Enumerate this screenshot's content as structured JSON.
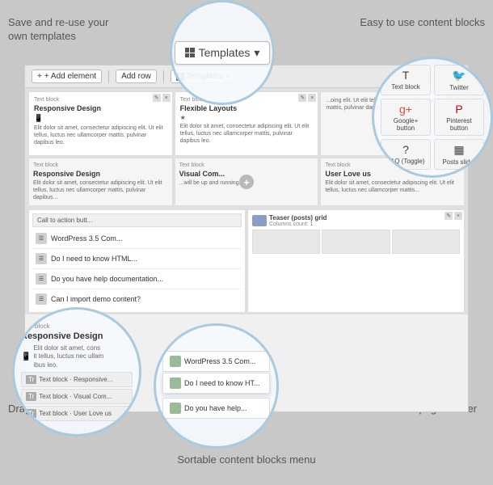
{
  "annotations": {
    "top_left": "Save and re-use your\nown templates",
    "top_right": "Easy to use content blocks",
    "bottom_left": "Drag and Drop interface",
    "bottom_right": "Powerful page builder",
    "bottom_center": "Sortable content blocks menu"
  },
  "toolbar": {
    "add_element": "+ Add element",
    "add_row": "Add row",
    "templates": "Templates"
  },
  "templates_button": {
    "label": "Templates",
    "arrow": "▾"
  },
  "content_blocks": {
    "items": [
      {
        "icon": "T",
        "label": "Text block"
      },
      {
        "icon": "🐦",
        "label": "Twitter"
      },
      {
        "icon": "g+",
        "label": "Google+ button"
      },
      {
        "icon": "P",
        "label": "Pinterest button"
      },
      {
        "icon": "?",
        "label": "FAQ (Toggle)"
      },
      {
        "icon": "▦",
        "label": "Posts slider"
      }
    ]
  },
  "drag_panel": {
    "header": "Text block",
    "title": "Responsive Design",
    "icon": "📱",
    "text": "Elit dolor sit amet, cons\nit tellus, luctus nec ullam\nibus leo.",
    "small_rows": [
      {
        "icon": "Tr",
        "label": "Text block\nResponsive Design"
      },
      {
        "icon": "Tr",
        "label": "Text block\nVisual Com..."
      },
      {
        "icon": "Tr",
        "label": "Text block\nUser Love us"
      }
    ]
  },
  "sortable_items": [
    {
      "label": "WordPress 3.5 Com..."
    },
    {
      "label": "Do I need to know HT..."
    },
    {
      "label": "Do you have help..."
    }
  ],
  "faq_items": [
    {
      "label": "WordPress 3.5 Com..."
    },
    {
      "label": "Do I need to know HTML..."
    },
    {
      "label": "Do you have help documentation..."
    },
    {
      "label": "Can I import demo content?"
    }
  ],
  "text_cells": {
    "cell1": {
      "header": "Text block",
      "title": "Responsive Design",
      "text": "Elit dolor sit amet, consectetur adipiscing elit. Ut elit tellus, luctus nec ullamcorper mattis, pulvinar dapibus leo."
    },
    "cell2": {
      "header": "Text block",
      "title": "Flexible Layouts",
      "text": "Elit dolor sit amet, consectetur adipiscing elit. Ut elit tellus, luctus nec ullamcorper mattis, pulvinar dapibus leo."
    },
    "cell3": {
      "header": "",
      "title": "",
      "text": "...oing elit. Ut elit tellus, luctus nec ullamcorper mattis, pulvinar dapibus..."
    },
    "cell4": {
      "header": "Text block",
      "title": "Responsive Design",
      "text": "Elit dolor sit amet, consectetur adipiscing elit. Ut elit tellus, luctus nec ullamcorper mattis, pulvinar dapibus..."
    },
    "cell5": {
      "header": "Text block",
      "title": "Visual Com...",
      "text": "...will be up and running..."
    },
    "cell6": {
      "header": "Text block",
      "title": "User Love us",
      "text": "Elit dolor sit amet, consectetur adipiscing elit. Ut elit tellus, luctus nec ullamcorper mattis..."
    }
  },
  "call_to_action": "Call to action butt...",
  "teaser": {
    "label": "Teaser (posts) grid",
    "sublabel": "Columns count: 1"
  }
}
